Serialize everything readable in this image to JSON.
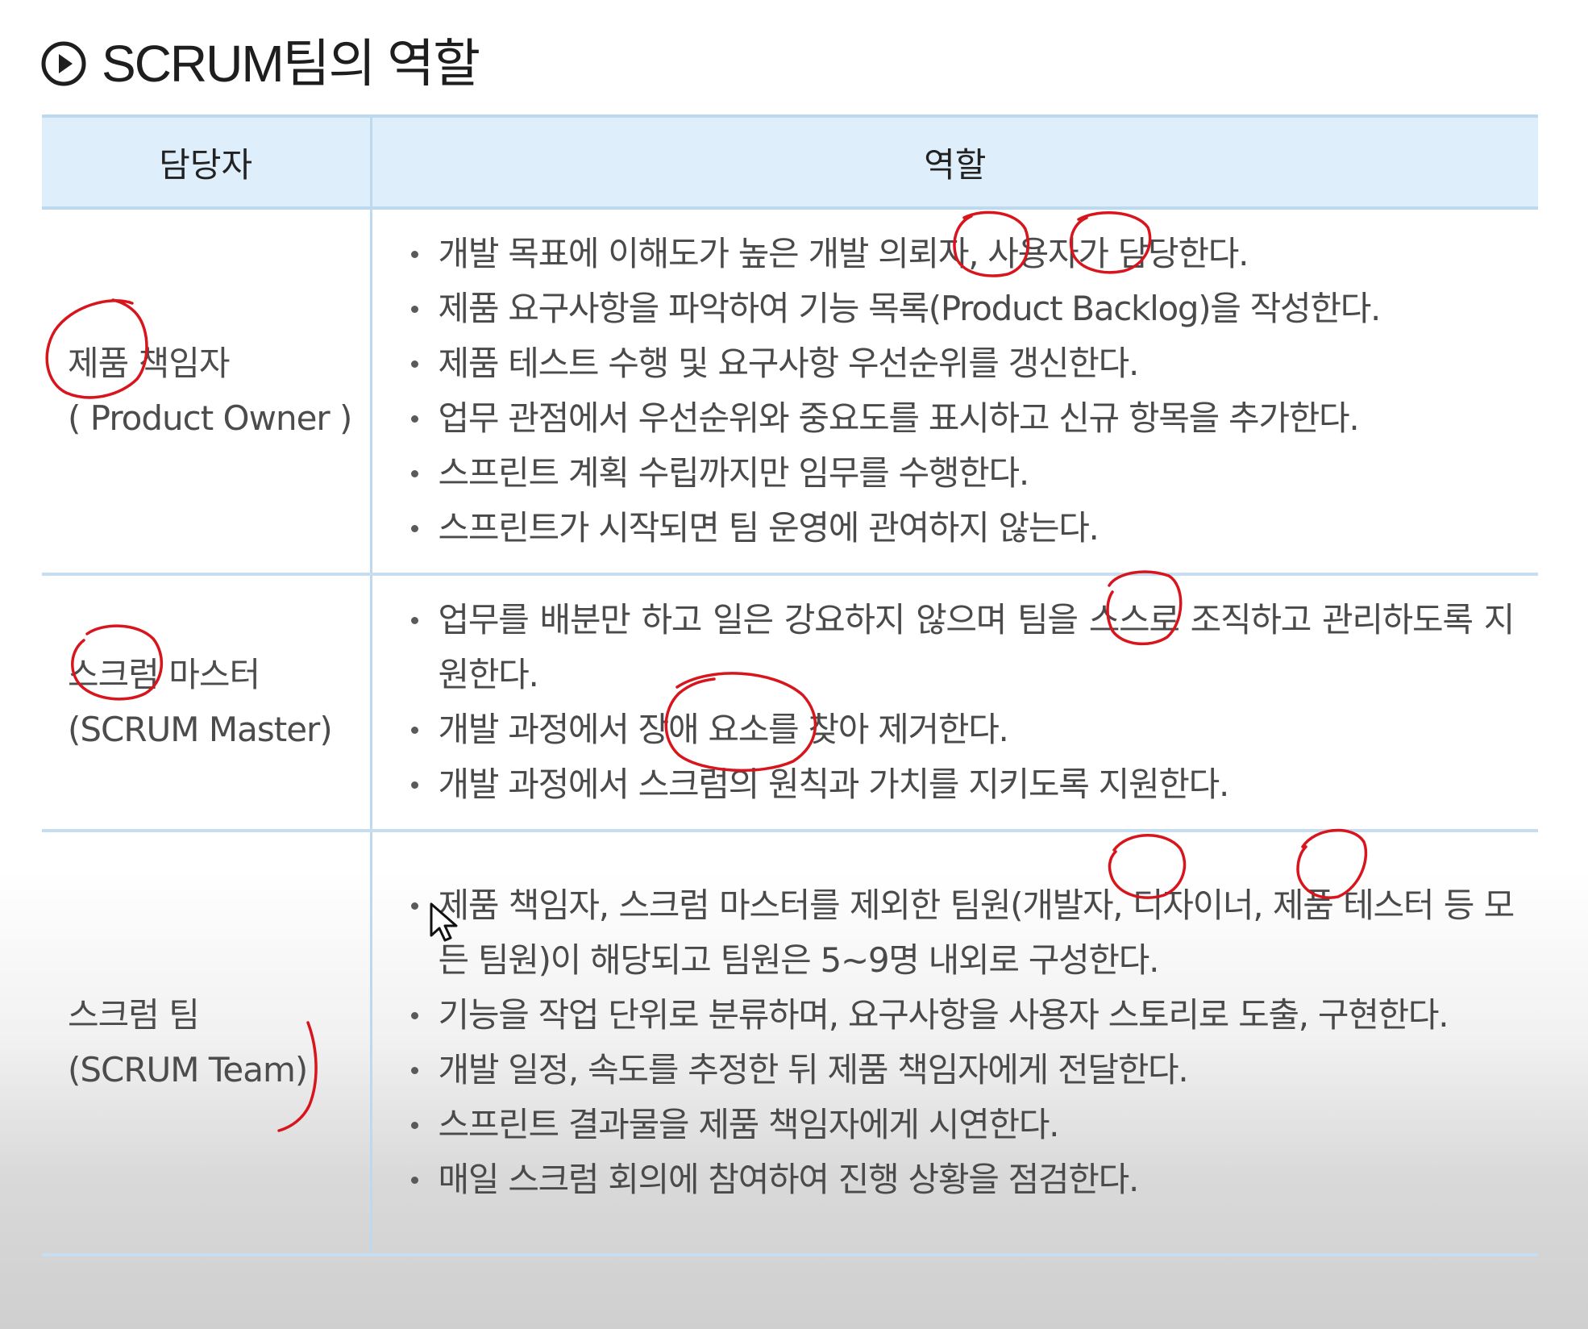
{
  "title": {
    "icon": "play-circle-icon",
    "text": "SCRUM팀의 역할"
  },
  "table": {
    "headers": {
      "owner": "담당자",
      "role": "역할"
    },
    "rows": [
      {
        "name": "제품 책임자",
        "name_en": "( Product Owner )",
        "roles": [
          "개발 목표에 이해도가 높은 개발 의뢰자, 사용자가 담당한다.",
          "제품 요구사항을 파악하여 기능 목록(Product Backlog)을 작성한다.",
          "제품 테스트 수행 및 요구사항 우선순위를 갱신한다.",
          "업무 관점에서 우선순위와 중요도를 표시하고 신규 항목을 추가한다.",
          "스프린트 계획 수립까지만 임무를 수행한다.",
          "스프린트가 시작되면 팀 운영에 관여하지 않는다."
        ]
      },
      {
        "name": "스크럼 마스터",
        "name_en": "(SCRUM Master)",
        "roles": [
          "업무를 배분만 하고 일은 강요하지 않으며 팀을 스스로 조직하고 관리하도록 지원한다.",
          "개발 과정에서 장애 요소를 찾아 제거한다.",
          "개발 과정에서 스크럼의 원칙과 가치를 지키도록 지원한다."
        ]
      },
      {
        "name": "스크럼 팀",
        "name_en": "(SCRUM Team)",
        "roles": [
          "제품 책임자, 스크럼 마스터를 제외한 팀원(개발자, 디자이너, 제품 테스터 등 모든 팀원)이 해당되고 팀원은 5~9명 내외로 구성한다.",
          "기능을 작업 단위로 분류하며, 요구사항을 사용자 스토리로 도출, 구현한다.",
          "개발 일정, 속도를 추정한 뒤 제품 책임자에게 전달한다.",
          "스프린트 결과물을 제품 책임자에게 시연한다.",
          "매일 스크럼 회의에 참여하여 진행 상황을 점검한다."
        ]
      }
    ]
  },
  "annotation_color": "#d8141c"
}
